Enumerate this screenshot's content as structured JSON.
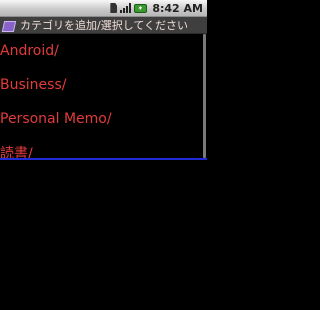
{
  "status_bar": {
    "time": "8:42 AM",
    "icons": [
      "sim-icon",
      "signal-icon",
      "battery-icon"
    ]
  },
  "title_bar": {
    "icon": "app-icon",
    "title": "カテゴリを追加/選択してください"
  },
  "categories": [
    {
      "label": "Android/"
    },
    {
      "label": "Business/"
    },
    {
      "label": "Personal Memo/"
    },
    {
      "label": "読書/"
    }
  ],
  "colors": {
    "item_text": "#e23b3b",
    "divider": "#1f2ad8",
    "background": "#000000"
  }
}
